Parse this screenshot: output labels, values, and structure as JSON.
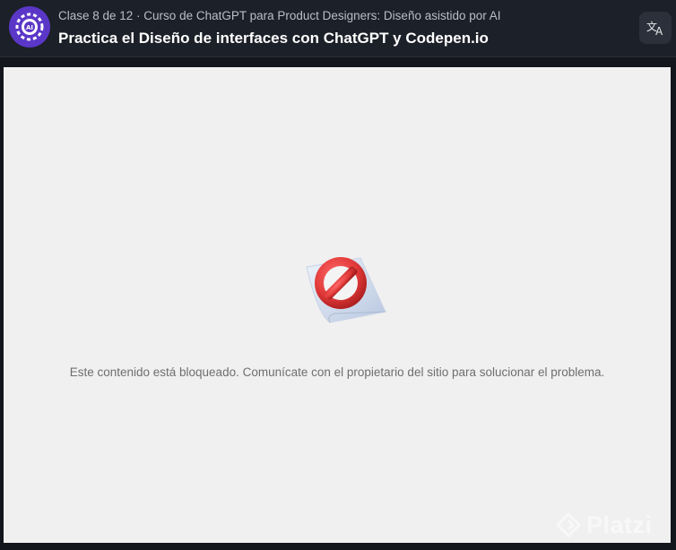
{
  "header": {
    "class_meta": "Clase 8 de 12 · Curso de ChatGPT para Product Designers: Diseño asistido por AI",
    "class_title": "Practica el Diseño de interfaces con ChatGPT y Codepen.io",
    "translate_icon": "translate-icon",
    "badge_icon": "ai-course-badge-icon"
  },
  "content": {
    "blocked_icon": "blocked-content-icon",
    "message": "Este contenido está bloqueado. Comunícate con el propietario del sitio para solucionar el problema."
  },
  "watermark": {
    "text": "Platzi",
    "icon": "platzi-logo-icon"
  },
  "colors": {
    "header_bg": "#1c2028",
    "page_bg": "#13161c",
    "content_bg": "#f0f0f0",
    "badge": "#5b37c8",
    "blocked_red": "#e23a3a"
  }
}
